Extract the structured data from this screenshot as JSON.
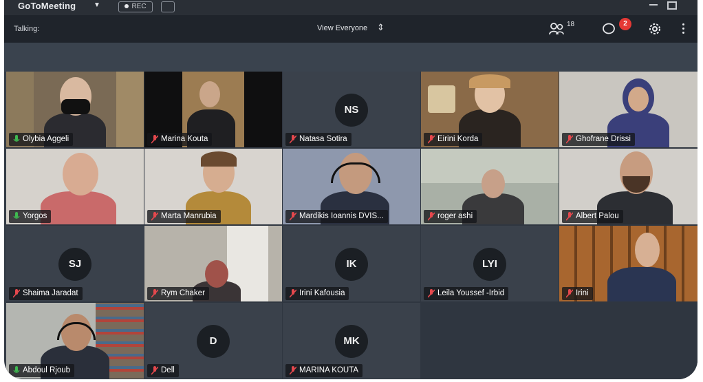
{
  "app": {
    "brand": "GoToMeeting",
    "rec_label": "REC"
  },
  "toolbar": {
    "talking_label": "Talking:",
    "view_label": "View Everyone",
    "participants_count": "18",
    "chat_badge": "2"
  },
  "participants": [
    {
      "name": "Olybia Aggeli",
      "mic": "on",
      "video": true
    },
    {
      "name": "Marina Kouta",
      "mic": "muted",
      "video": true
    },
    {
      "name": "Natasa Sotira",
      "mic": "muted",
      "video": false,
      "initials": "NS"
    },
    {
      "name": "Eirini Korda",
      "mic": "muted",
      "video": true
    },
    {
      "name": "Ghofrane Drissi",
      "mic": "muted",
      "video": true
    },
    {
      "name": "Yorgos",
      "mic": "on",
      "video": true
    },
    {
      "name": "Marta Manrubia",
      "mic": "muted",
      "video": true
    },
    {
      "name": "Mardikis Ioannis DVIS...",
      "mic": "muted",
      "video": true
    },
    {
      "name": "roger ashi",
      "mic": "muted",
      "video": true
    },
    {
      "name": "Albert Palou",
      "mic": "muted",
      "video": true
    },
    {
      "name": "Shaima Jaradat",
      "mic": "muted",
      "video": false,
      "initials": "SJ"
    },
    {
      "name": "Rym Chaker",
      "mic": "muted",
      "video": true
    },
    {
      "name": "Irini Kafousia",
      "mic": "muted",
      "video": false,
      "initials": "IK"
    },
    {
      "name": "Leila Youssef -Irbid",
      "mic": "muted",
      "video": false,
      "initials": "LYI"
    },
    {
      "name": "Irini",
      "mic": "muted",
      "video": true
    },
    {
      "name": "Abdoul Rjoub",
      "mic": "on",
      "video": true
    },
    {
      "name": "Dell",
      "mic": "muted",
      "video": false,
      "initials": "D"
    },
    {
      "name": "MARINA KOUTA",
      "mic": "muted",
      "video": false,
      "initials": "MK"
    }
  ],
  "colors": {
    "mic_on": "#3fb950",
    "mic_muted": "#e5484d",
    "badge": "#e53935",
    "toolbar_bg": "#1f242b",
    "grid_bg": "#2f3640"
  },
  "icons": [
    "people-icon",
    "chat-icon",
    "gear-icon",
    "kebab-icon",
    "swap-icon",
    "mic-icon",
    "mic-muted-icon"
  ]
}
